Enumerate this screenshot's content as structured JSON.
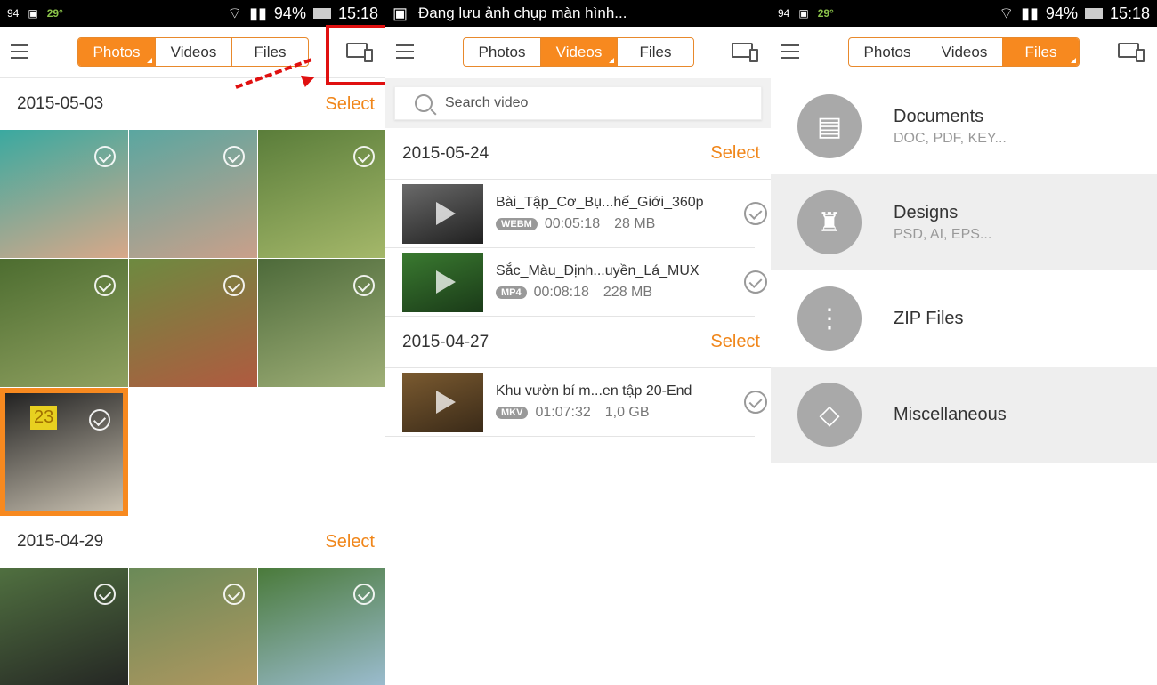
{
  "status": {
    "badge": "94",
    "temp": "29°",
    "battery": "94%",
    "time": "15:18",
    "notification": "Đang lưu ảnh chụp màn hình..."
  },
  "tabs": [
    "Photos",
    "Videos",
    "Files"
  ],
  "photos": {
    "groups": [
      {
        "date": "2015-05-03",
        "select": "Select",
        "badge": "23",
        "colors": [
          "#3aa9a0,#d8a889",
          "#5aa6a0,#caa08a",
          "#5a7d3a,#a5b86a",
          "#4d6d30,#8fa060",
          "#6d8a40,#b05a40",
          "#4d6a3a,#a0b078",
          "#222,#c8c0b0"
        ]
      },
      {
        "date": "2015-04-29",
        "select": "Select",
        "colors": [
          "#507040,#222",
          "#6a8a58,#b49860",
          "#4a7a3a,#a0c0d8"
        ]
      }
    ]
  },
  "videos": {
    "search_placeholder": "Search video",
    "groups": [
      {
        "date": "2015-05-24",
        "select": "Select",
        "items": [
          {
            "name": "Bài_Tập_Cơ_Bụ...hế_Giới_360p",
            "format": "WEBM",
            "duration": "00:05:18",
            "size": "28 MB",
            "colors": "#6a6a6a,#202020"
          },
          {
            "name": "Sắc_Màu_Định...uyền_Lá_MUX",
            "format": "MP4",
            "duration": "00:08:18",
            "size": "228 MB",
            "colors": "#3a7a30,#1a3a18"
          }
        ]
      },
      {
        "date": "2015-04-27",
        "select": "Select",
        "items": [
          {
            "name": "Khu vườn bí m...en tập 20-End",
            "format": "MKV",
            "duration": "01:07:32",
            "size": "1,0 GB",
            "colors": "#7a5a30,#3a2a18"
          }
        ]
      }
    ]
  },
  "files": [
    {
      "name": "Documents",
      "sub": "DOC, PDF, KEY...",
      "icon": "document-icon",
      "glyph": "▤"
    },
    {
      "name": "Designs",
      "sub": "PSD, AI, EPS...",
      "icon": "brush-icon",
      "glyph": "♜"
    },
    {
      "name": "ZIP Files",
      "sub": "",
      "icon": "zip-icon",
      "glyph": "⋮"
    },
    {
      "name": "Miscellaneous",
      "sub": "",
      "icon": "puzzle-icon",
      "glyph": "◇"
    }
  ],
  "colors": {
    "accent": "#f7891f",
    "highlight": "#e01010"
  }
}
